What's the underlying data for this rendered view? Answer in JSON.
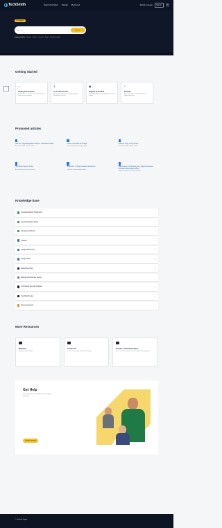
{
  "nav": {
    "logo": "TechSmith",
    "links": [
      "Support by Product",
      "Tutorials",
      "My Account"
    ],
    "submit_request": "Submit a request",
    "sign_in": "Sign in",
    "avatar": "TS"
  },
  "hero": {
    "badge": "Get Support",
    "search_placeholder": "Search...",
    "search_button": "Search",
    "popular_label": "popular searches:",
    "popular_items": [
      "Upgrade,",
      "Activate,",
      "Camtasia,",
      "Snagit,",
      "Video Review Alert"
    ]
  },
  "getting_started": {
    "title": "Getting Started",
    "cards": [
      {
        "icon": "⌂",
        "title": "Buying and Licenses",
        "text": "Find answers to common sales, purchasing and other common questions"
      },
      {
        "icon": "⚲",
        "title": "Go To My Account",
        "text": "Manage your subscriptions, update payment information, and more"
      },
      {
        "icon": "▦",
        "title": "Support by Product",
        "text": "TechSmith Support Knowledge Base articles by product"
      },
      {
        "icon": "⚐",
        "title": "Get Help",
        "text": "Get in touch with our TechSmith team of Support Specialists"
      }
    ]
  },
  "promoted": {
    "title": "Promoted articles",
    "articles": [
      {
        "title": "How do I Upgrade/Update Snagit or Camtasia Output?",
        "meta": "As of February 25, 2025 the other ..."
      },
      {
        "title": "Close Instructions for Snagit",
        "meta": "If you are getting a message saying ..."
      },
      {
        "title": "I Need a Copy of My Invoice",
        "meta": "Online Store Orders Online Orders ..."
      },
      {
        "title": "TechSmith Support Policy",
        "meta": "As we work to put more information ..."
      },
      {
        "title": "TechSmith IT Implementation Resources",
        "meta": "Full list of Camtasia downloadable ..."
      },
      {
        "title": "Maintenance Transitioning to a Support Resource (Camtasia Subscription Plan)",
        "meta": "Updated: December 18, 2023. What this ..."
      }
    ]
  },
  "knowledge_base": {
    "title": "Knowledge base",
    "items": [
      {
        "label": "Camtasia Editor (Windows)",
        "color": "#2aa84a"
      },
      {
        "label": "Camtasia Editor (Mac)",
        "color": "#2aa84a"
      },
      {
        "label": "Camtasia (Online)",
        "color": "#2aa84a"
      },
      {
        "label": "Audiate",
        "color": "#3a6fd8"
      },
      {
        "label": "Snagit (Windows)",
        "color": "#2b7bd6"
      },
      {
        "label": "Snagit (Mac)",
        "color": "#2b7bd6"
      },
      {
        "label": "Enterprise Help",
        "color": "#1d2330"
      },
      {
        "label": "Buying and License Issues",
        "color": "#6b7383"
      },
      {
        "label": "TechSmith Security Policies",
        "color": "#1d2330"
      },
      {
        "label": "TechSmith Labs",
        "color": "#1d2330"
      },
      {
        "label": "Screencast.com",
        "color": "#f08a24"
      }
    ]
  },
  "more_resources": {
    "title": "More Resources",
    "cards": [
      {
        "title": "Webinars",
        "text": "Explore our free webinars"
      },
      {
        "title": "Contact Us",
        "text": "Contact us when you need personal support"
      },
      {
        "title": "Contact a Camtasia Expert",
        "text": "Hire a Camtasia expert for a course to assist with your project"
      }
    ]
  },
  "get_help": {
    "title": "Get Help",
    "text": "Get in touch with our TechSmith team of Support Specialists",
    "button": "Submit a request"
  },
  "footer": {
    "text": "© TechSmith Support"
  }
}
